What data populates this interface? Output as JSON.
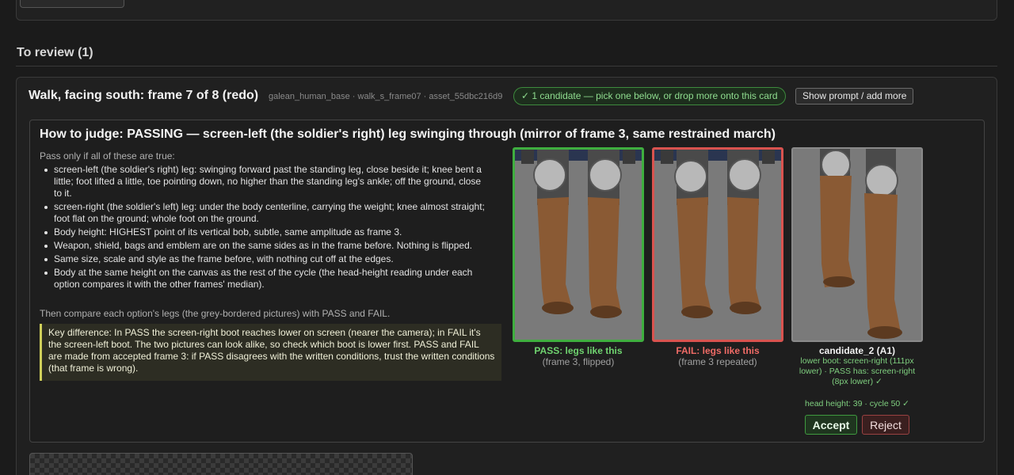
{
  "review_section": {
    "title": "To review (1)"
  },
  "card": {
    "title": "Walk, facing south: frame 7 of 8 (redo)",
    "meta": "galean_human_base · walk_s_frame07 · asset_55dbc216d9",
    "candidate_badge": "✓ 1 candidate — pick one below, or drop more onto this card",
    "show_prompt_label": "Show prompt / add more"
  },
  "judge": {
    "title": "How to judge: PASSING — screen-left (the soldier's right) leg swinging through (mirror of frame 3, same restrained march)",
    "intro": "Pass only if all of these are true:",
    "conditions": [
      "screen-left (the soldier's right) leg: swinging forward past the standing leg, close beside it; knee bent a little; foot lifted a little, toe pointing down, no higher than the standing leg's ankle; off the ground, close to it.",
      "screen-right (the soldier's left) leg: under the body centerline, carrying the weight; knee almost straight; foot flat on the ground; whole foot on the ground.",
      "Body height: HIGHEST point of its vertical bob, subtle, same amplitude as frame 3.",
      "Weapon, shield, bags and emblem are on the same sides as in the frame before. Nothing is flipped.",
      "Same size, scale and style as the frame before, with nothing cut off at the edges.",
      "Body at the same height on the canvas as the rest of the cycle (the head-height reading under each option compares it with the other frames' median)."
    ],
    "compare_note": "Then compare each option's legs (the grey-bordered pictures) with PASS and FAIL.",
    "key_difference": "Key difference: In PASS the screen-right boot reaches lower on screen (nearer the camera); in FAIL it's the screen-left boot. The two pictures can look alike, so check which boot is lower first. PASS and FAIL are made from accepted frame 3: if PASS disagrees with the written conditions, trust the written conditions (that frame is wrong)."
  },
  "options": {
    "pass": {
      "label": "PASS: legs like this",
      "sub": "(frame 3, flipped)"
    },
    "fail": {
      "label": "FAIL: legs like this",
      "sub": "(frame 3 repeated)"
    },
    "candidate": {
      "label": "candidate_2 (A1)",
      "detail": "lower boot: screen-right (111px lower) · PASS has: screen-right (8px lower) ✓",
      "head_height": "head height: 39 · cycle 50 ✓",
      "accept_label": "Accept",
      "reject_label": "Reject"
    }
  },
  "colors": {
    "pass_border": "#3fae3f",
    "fail_border": "#d9534f",
    "candidate_border": "#8a8a8a",
    "key_diff_accent": "#cfcf5a"
  }
}
